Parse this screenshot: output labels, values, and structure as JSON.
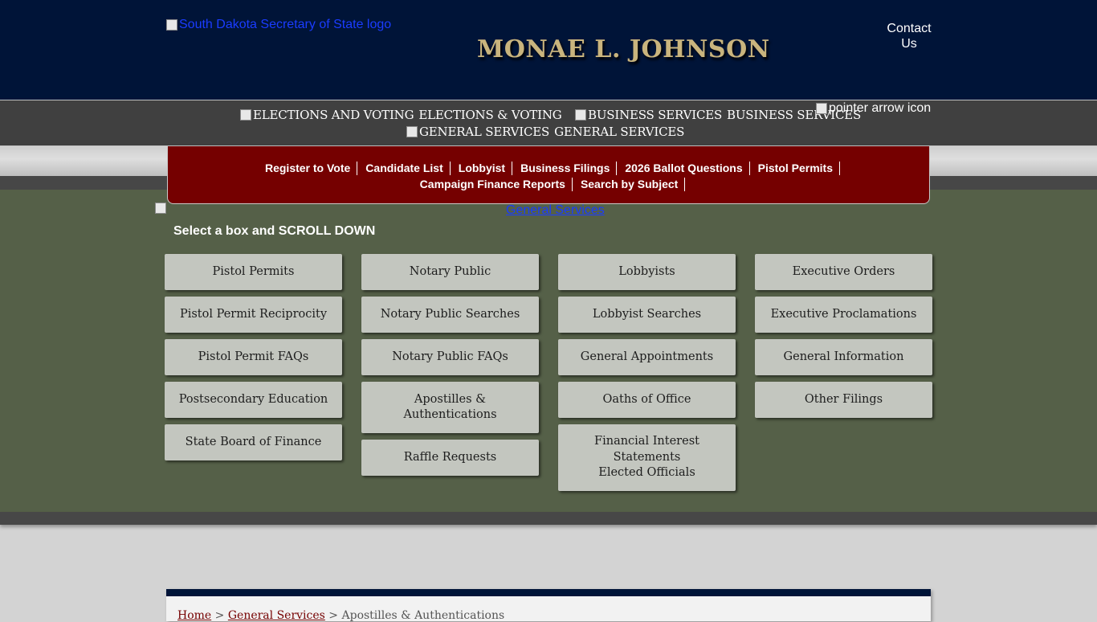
{
  "header": {
    "logo_alt": "South Dakota Secretary of State logo",
    "site_title": "MONAE L. JOHNSON",
    "contact_label": "Contact Us"
  },
  "nav": {
    "items": [
      {
        "alt": "ELECTIONS AND VOTING",
        "label": "ELECTIONS & VOTING"
      },
      {
        "alt": "BUSINESS SERVICES",
        "label": "BUSINESS SERVICES"
      },
      {
        "alt": "GENERAL SERVICES",
        "label": "GENERAL SERVICES"
      }
    ],
    "pointer_alt": "pointer arrow icon"
  },
  "quick_links": [
    "Register to Vote",
    "Candidate List",
    "Lobbyist",
    "Business Filings",
    "2026 Ballot Questions",
    "Pistol Permits",
    "Campaign Finance Reports",
    "Search by Subject"
  ],
  "main": {
    "section_link": "General Services",
    "instruction": "Select a box and SCROLL DOWN",
    "columns": [
      [
        "Pistol Permits",
        "Pistol Permit Reciprocity",
        "Pistol Permit FAQs",
        "Postsecondary Education",
        "State Board of Finance"
      ],
      [
        "Notary Public",
        "Notary Public Searches",
        "Notary Public FAQs",
        "Apostilles &\nAuthentications",
        "Raffle Requests"
      ],
      [
        "Lobbyists",
        "Lobbyist Searches",
        "General Appointments",
        "Oaths of Office",
        "Financial Interest\nStatements\nElected Officials"
      ],
      [
        "Executive Orders",
        "Executive Proclamations",
        "General Information",
        "Other Filings"
      ]
    ]
  },
  "breadcrumb": {
    "home": "Home",
    "sep": " > ",
    "section": "General Services",
    "current": "Apostilles & Authentications"
  }
}
